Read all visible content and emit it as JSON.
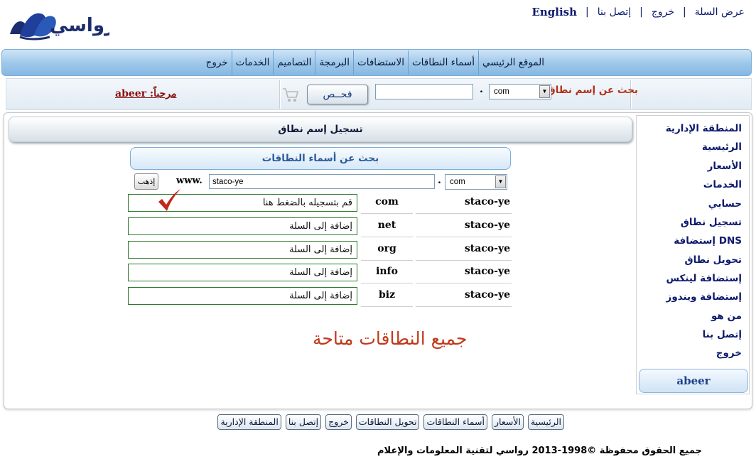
{
  "brand": {
    "logo_text": "رواسي",
    "colors": {
      "accent": "#1a3f8a",
      "title_red": "#b3301a",
      "nav_blue": "#9cc7ea",
      "success_green": "#2e7a2e"
    }
  },
  "toplinks": [
    {
      "label": "عرض السلة"
    },
    {
      "label": "خروج"
    },
    {
      "label": "إتصل بنا"
    },
    {
      "label": "English"
    }
  ],
  "nav": {
    "items": [
      {
        "label": "الموقع الرئيسي"
      },
      {
        "label": "أسماء النطاقات"
      },
      {
        "label": "الاستضافات"
      },
      {
        "label": "البرمجة"
      },
      {
        "label": "التصاميم"
      },
      {
        "label": "الخدمات"
      },
      {
        "label": "خروج"
      }
    ]
  },
  "quicksearch": {
    "title": "بحث عن إسم نطاق",
    "tld_selected": "com",
    "domain_value": "",
    "dot": ".",
    "check_label": "فحــص",
    "cart_icon": "cart-icon",
    "welcome": "مرحباً: abeer"
  },
  "sidebar": {
    "items": [
      {
        "label": "المنطقة الإدارية"
      },
      {
        "label": "الرئيسية"
      },
      {
        "label": "الأسعار"
      },
      {
        "label": "الخدمات"
      },
      {
        "label": "حسابي"
      },
      {
        "label": "تسجيل نطاق"
      },
      {
        "label": "إستضافة DNS"
      },
      {
        "label": "تحويل نطاق"
      },
      {
        "label": "إستضافة لينكس"
      },
      {
        "label": "إستضافة ويندوز"
      },
      {
        "label": "من هو"
      },
      {
        "label": "إتصل بنا"
      },
      {
        "label": "خروج"
      }
    ],
    "username": "abeer"
  },
  "main": {
    "title": "تسجيل إسم نطاق",
    "subtitle": "بحث عن أسماء النطاقات",
    "go_label": "إذهب",
    "www": "www.",
    "domain_value": "staco-ye",
    "dot": ".",
    "tld_selected": "com",
    "results": [
      {
        "name": "staco-ye",
        "ext": "com",
        "action": "قم بتسجيله بالضغط هنا"
      },
      {
        "name": "staco-ye",
        "ext": "net",
        "action": "إضافة إلى السلة"
      },
      {
        "name": "staco-ye",
        "ext": "org",
        "action": "إضافة إلى السلة"
      },
      {
        "name": "staco-ye",
        "ext": "info",
        "action": "إضافة إلى السلة"
      },
      {
        "name": "staco-ye",
        "ext": "biz",
        "action": "إضافة إلى السلة"
      }
    ],
    "status": "جميع النطاقات متاحة"
  },
  "footer": {
    "links": [
      {
        "label": "الرئيسية"
      },
      {
        "label": "الأسعار"
      },
      {
        "label": "أسماء النطاقات"
      },
      {
        "label": "تحويل النطاقات"
      },
      {
        "label": "خروج"
      },
      {
        "label": "إتصل بنا"
      },
      {
        "label": "المنطقة الإدارية"
      }
    ],
    "copyright": "جميع الحقوق محفوظة ©1998-2013 رواسي لتقنية المعلومات والإعلام"
  }
}
